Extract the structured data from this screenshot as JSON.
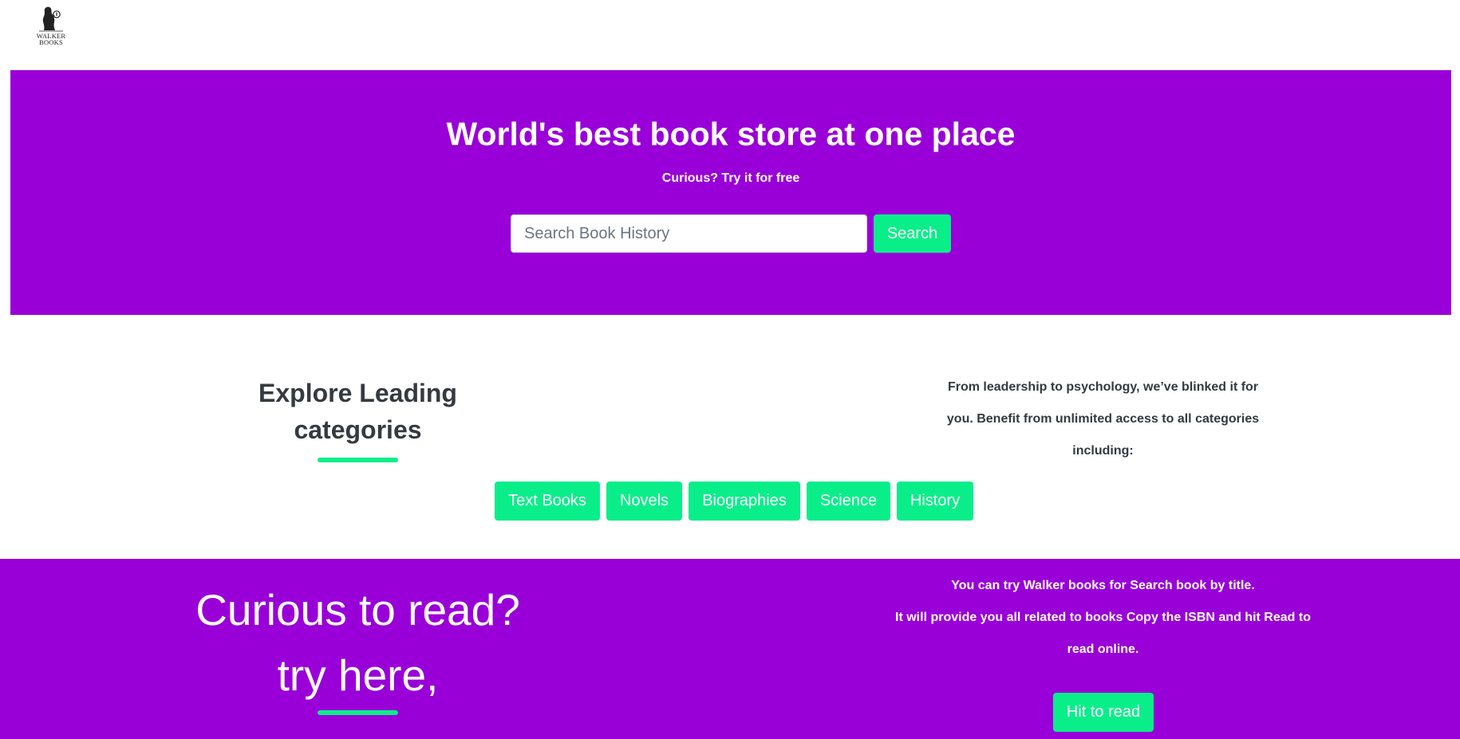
{
  "header": {
    "logo_line1": "WALKER",
    "logo_line2": "BOOKS",
    "logo_icon": "bear-with-lantern-icon"
  },
  "hero": {
    "title": "World's best book store at one place",
    "subtitle": "Curious? Try it for free",
    "search_placeholder": "Search Book History",
    "search_value": "",
    "search_button": "Search"
  },
  "categories": {
    "heading": "Explore Leading categories",
    "description": "From leadership to psychology, we’ve blinked it for you. Benefit from unlimited access to all categories including:",
    "items": [
      {
        "label": "Text Books"
      },
      {
        "label": "Novels"
      },
      {
        "label": "Biographies"
      },
      {
        "label": "Science"
      },
      {
        "label": "History"
      }
    ]
  },
  "read_section": {
    "heading_line1": "Curious to read?",
    "heading_line2": "try here,",
    "description_line1": "You can try Walker books for Search book by title.",
    "description_line2": "It will provide you all related to books Copy the ISBN and hit Read to read online.",
    "button": "Hit to read"
  },
  "colors": {
    "brand_purple": "#9900d8",
    "accent_green": "#0aee8a",
    "text_dark": "#343a40"
  }
}
